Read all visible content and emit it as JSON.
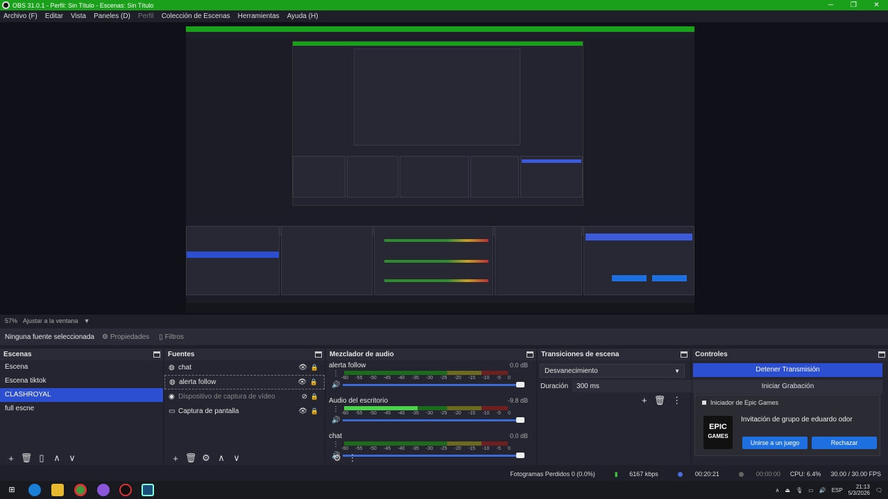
{
  "window": {
    "title": "OBS 31.0.1 - Perfil: Sin Título - Escenas: Sin Título",
    "controls": [
      "─",
      "❐",
      "✕"
    ]
  },
  "menu": [
    "Archivo (F)",
    "Editar",
    "Vista",
    "Paneles (D)",
    "Perfil",
    "Colección de Escenas",
    "Herramientas",
    "Ayuda (H)"
  ],
  "zoom": {
    "level": "57%",
    "fit": "Ajustar a la ventana"
  },
  "properties_bar": {
    "no_source": "Ninguna fuente seleccionada",
    "properties": "Propiedades",
    "filters": "Filtros"
  },
  "scenes": {
    "title": "Escenas",
    "items": [
      "Escena",
      "Escena tiktok",
      "CLASHROYAL",
      "full escne"
    ],
    "selected": "CLASHROYAL"
  },
  "sources": {
    "title": "Fuentes",
    "items": [
      {
        "label": "chat",
        "icon": "globe-icon"
      },
      {
        "label": "alerta follow",
        "icon": "globe-icon"
      },
      {
        "label": "Dispositivo de captura de vídeo",
        "icon": "camera-icon"
      },
      {
        "label": "Captura de pantalla",
        "icon": "monitor-icon"
      }
    ]
  },
  "mixer": {
    "title": "Mezclador de audio",
    "ticks": [
      "-60",
      "-55",
      "-50",
      "-45",
      "-40",
      "-35",
      "-30",
      "-25",
      "-20",
      "-15",
      "-10",
      "-5",
      "0"
    ],
    "channels": [
      {
        "name": "alerta follow",
        "db": "0.0 dB",
        "level": 0.0
      },
      {
        "name": "Audio del escritorio",
        "db": "-9.8 dB",
        "level": 0.45
      },
      {
        "name": "chat",
        "db": "0.0 dB",
        "level": 0.0
      }
    ]
  },
  "transitions": {
    "title": "Transiciones de escena",
    "selected": "Desvanecimiento",
    "duration_label": "Duración",
    "duration_value": "300 ms"
  },
  "controls": {
    "title": "Controles",
    "stop_stream": "Detener Transmisión",
    "start_record": "Iniciar Grabación"
  },
  "toast": {
    "app": "Iniciador de Epic Games",
    "logo_line1": "EPIC",
    "logo_line2": "GAMES",
    "message": "Invitación de grupo de eduardo odor",
    "join": "Unirse a un juego",
    "reject": "Rechazar"
  },
  "status": {
    "dropped": "Fotogramas Perdidos 0 (0.0%)",
    "bitrate": "6167 kbps",
    "stream_time": "00:20:21",
    "rec_time": "00:00:00",
    "cpu": "CPU: 6.4%",
    "fps": "30.00 / 30.00 FPS"
  },
  "taskbar": {
    "lang": "ESP",
    "time": "21:13",
    "date": "5/3/2026"
  },
  "colors": {
    "obs_green": "#1aa01a",
    "selection_blue": "#2b4fd0",
    "epic_blue": "#1e6fe0"
  }
}
